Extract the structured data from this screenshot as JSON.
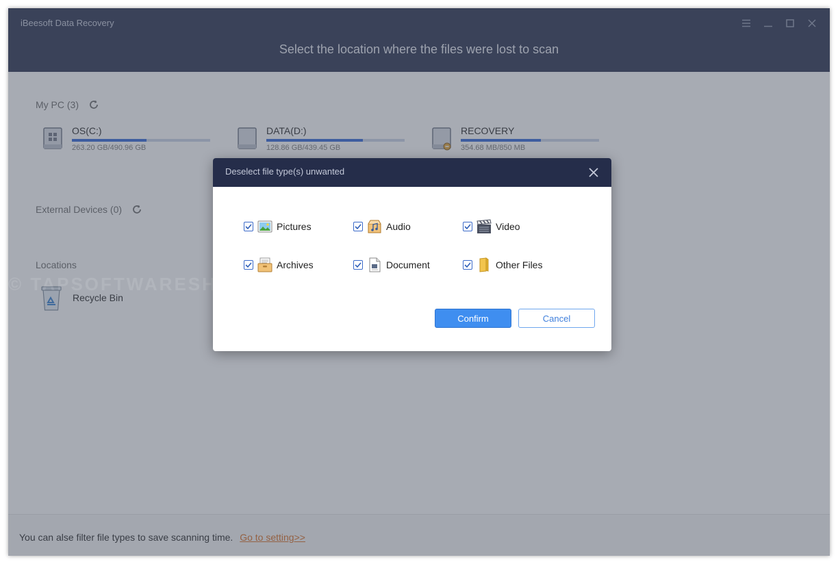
{
  "app": {
    "title": "iBeesoft Data Recovery",
    "heading": "Select the location where the files were lost to scan"
  },
  "window_controls": [
    "menu-icon",
    "minimize-icon",
    "maximize-icon",
    "close-icon"
  ],
  "my_pc": {
    "label": "My PC (3)",
    "drives": [
      {
        "name": "OS(C:)",
        "size": "263.20 GB/490.96 GB",
        "used_fraction": 0.54,
        "icon": "windows-drive-icon"
      },
      {
        "name": "DATA(D:)",
        "size": "128.86 GB/439.45 GB",
        "used_fraction": 0.7,
        "icon": "hard-drive-icon"
      },
      {
        "name": "RECOVERY",
        "size": "354.68 MB/850 MB",
        "used_fraction": 0.58,
        "icon": "recovery-drive-icon"
      }
    ]
  },
  "external_devices": {
    "label": "External Devices (0)"
  },
  "locations": {
    "label": "Locations",
    "items": [
      {
        "name": "Recycle Bin",
        "icon": "recycle-bin-icon"
      }
    ]
  },
  "watermark": "© TAPSOFTWARESHOP",
  "footer": {
    "text": "You can alse filter file types to save scanning time.",
    "link": "Go to setting>>"
  },
  "dialog": {
    "title": "Deselect file type(s) unwanted",
    "file_types": [
      {
        "label": "Pictures",
        "checked": true,
        "icon": "pictures-icon"
      },
      {
        "label": "Audio",
        "checked": true,
        "icon": "audio-icon"
      },
      {
        "label": "Video",
        "checked": true,
        "icon": "video-icon"
      },
      {
        "label": "Archives",
        "checked": true,
        "icon": "archives-icon"
      },
      {
        "label": "Document",
        "checked": true,
        "icon": "document-icon"
      },
      {
        "label": "Other Files",
        "checked": true,
        "icon": "folder-icon"
      }
    ],
    "confirm": "Confirm",
    "cancel": "Cancel"
  },
  "colors": {
    "header_bg": "#252d4a",
    "accent": "#3f8ef0",
    "drive_bar": "#2d63d6",
    "link": "#d86a1e"
  }
}
